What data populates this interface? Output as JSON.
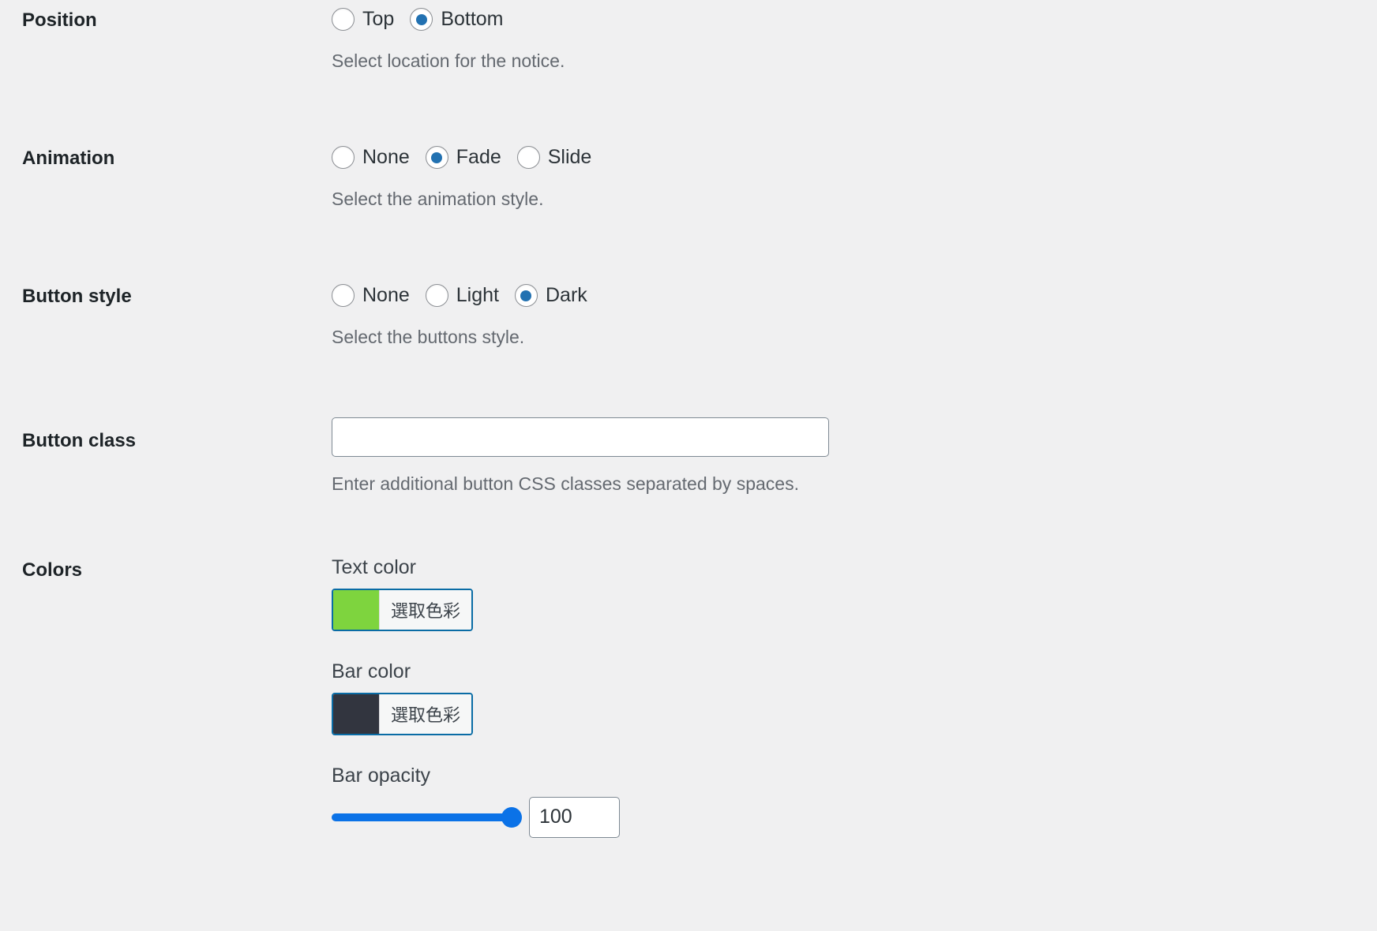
{
  "form": {
    "rows": [
      {
        "id": "position",
        "label": "Position",
        "type": "radio",
        "options": [
          {
            "label": "Top",
            "checked": false
          },
          {
            "label": "Bottom",
            "checked": true
          }
        ],
        "description": "Select location for the notice."
      },
      {
        "id": "animation",
        "label": "Animation",
        "type": "radio",
        "options": [
          {
            "label": "None",
            "checked": false
          },
          {
            "label": "Fade",
            "checked": true
          },
          {
            "label": "Slide",
            "checked": false
          }
        ],
        "description": "Select the animation style."
      },
      {
        "id": "button-style",
        "label": "Button style",
        "type": "radio",
        "options": [
          {
            "label": "None",
            "checked": false
          },
          {
            "label": "Light",
            "checked": false
          },
          {
            "label": "Dark",
            "checked": true
          }
        ],
        "description": "Select the buttons style."
      },
      {
        "id": "button-class",
        "label": "Button class",
        "type": "text",
        "value": "",
        "placeholder": "",
        "description": "Enter additional button CSS classes separated by spaces."
      },
      {
        "id": "colors",
        "label": "Colors",
        "type": "colors",
        "text_color": {
          "label": "Text color",
          "swatch": "#7ed43e",
          "button_label": "選取色彩"
        },
        "bar_color": {
          "label": "Bar color",
          "swatch": "#32353f",
          "button_label": "選取色彩"
        },
        "bar_opacity": {
          "label": "Bar opacity",
          "value": "100",
          "min": 0,
          "max": 100,
          "percent": 100,
          "accent": "#0b72e7"
        }
      }
    ]
  }
}
